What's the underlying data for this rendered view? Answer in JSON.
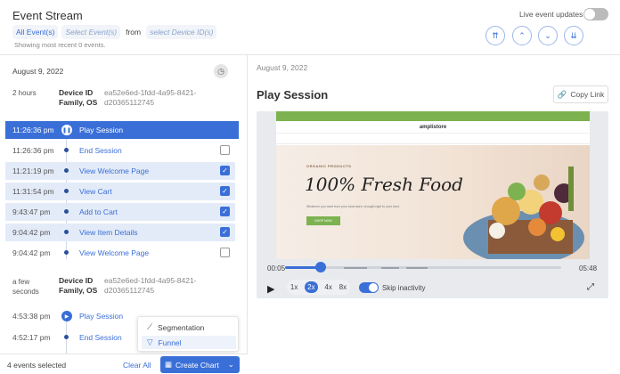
{
  "header": {
    "title": "Event Stream",
    "chip_all_events": "All Event(s)",
    "chip_select_events": "Select Event(s)",
    "from_text": "from",
    "chip_select_device": "select Device ID(s)",
    "showing": "Showing most recent 0 events.",
    "live_label": "Live event updates",
    "live_on": false
  },
  "left": {
    "date": "August 9, 2022",
    "session1": {
      "ago": "2 hours",
      "device_label": "Device ID Family, OS",
      "device_id": "ea52e6ed-1fdd-4a95-8421-d20365112745"
    },
    "session1_events": [
      {
        "time": "11:26:36 pm",
        "name": "Play Session",
        "kind": "head",
        "checked": null
      },
      {
        "time": "11:26:36 pm",
        "name": "End Session",
        "kind": "event",
        "checked": false
      },
      {
        "time": "11:21:19 pm",
        "name": "View Welcome Page",
        "kind": "event",
        "checked": true
      },
      {
        "time": "11:31:54 pm",
        "name": "View Cart",
        "kind": "event",
        "checked": true
      },
      {
        "time": "9:43:47 pm",
        "name": "Add to Cart",
        "kind": "event",
        "checked": true
      },
      {
        "time": "9:04:42 pm",
        "name": "View Item Details",
        "kind": "event",
        "checked": true
      },
      {
        "time": "9:04:42 pm",
        "name": "View Welcome Page",
        "kind": "event",
        "checked": false
      }
    ],
    "session2": {
      "ago": "a few seconds",
      "device_label": "Device ID Family, OS",
      "device_id": "ea52e6ed-1fdd-4a95-8421-d20365112745"
    },
    "session2_events": [
      {
        "time": "4:53:38 pm",
        "name": "Play Session"
      },
      {
        "time": "4:52:17 pm",
        "name": "End Session"
      }
    ],
    "selected_count": "4 events selected",
    "clear_all": "Clear All",
    "create_chart": "Create Chart",
    "menu": {
      "segmentation": "Segmentation",
      "funnel": "Funnel"
    }
  },
  "right": {
    "date": "August 9, 2022",
    "title": "Play Session",
    "copy_link": "Copy Link",
    "site": {
      "brand": "amplistore",
      "organic": "ORGANIC PRODUCTS",
      "hero_title": "100% Fresh Food",
      "hero_sub": "Whatever you want from your local store, brought right to your door.",
      "shop_now": "SHOP NOW"
    },
    "time_start": "00:05",
    "time_end": "05:48",
    "progress": 0.13,
    "speeds": [
      "1x",
      "2x",
      "4x",
      "8x"
    ],
    "speed_selected": "2x",
    "skip_label": "Skip inactivity",
    "skip_on": true
  },
  "colors": {
    "accent": "#3a6fd8",
    "selected_row": "#e3ebf8",
    "site_green": "#7cb24f"
  }
}
